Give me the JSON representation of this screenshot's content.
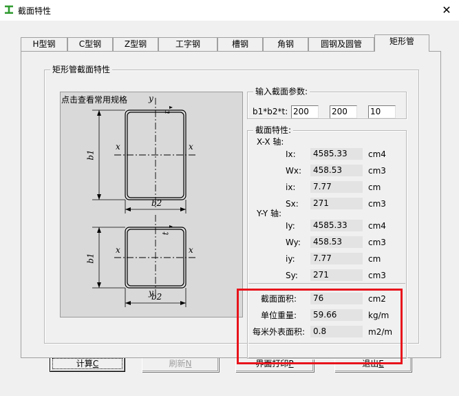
{
  "window": {
    "title": "截面特性",
    "close_glyph": "✕"
  },
  "tabs": [
    {
      "label": "H型钢"
    },
    {
      "label": "C型钢"
    },
    {
      "label": "Z型钢"
    },
    {
      "label": "工字钢"
    },
    {
      "label": "槽钢"
    },
    {
      "label": "角钢"
    },
    {
      "label": "圆钢及圆管"
    },
    {
      "label": "矩形管"
    }
  ],
  "main_group": {
    "title": "矩形管截面特性"
  },
  "diagram": {
    "link_text": "点击查看常用规格",
    "label_y": "y",
    "label_x": "x",
    "label_t": "t",
    "label_b1": "b1",
    "label_b2": "b2"
  },
  "input_group": {
    "title": "输入截面参数:",
    "param_label": "b1*b2*t:",
    "b1": "200",
    "b2": "200",
    "t": "10"
  },
  "props_group": {
    "title": "截面特性:",
    "xx_axis": "X-X 轴:",
    "yy_axis": "Y-Y 轴:",
    "rows": [
      {
        "label": "Ix:",
        "value": "4585.33",
        "unit": "cm4"
      },
      {
        "label": "Wx:",
        "value": "458.53",
        "unit": "cm3"
      },
      {
        "label": "ix:",
        "value": "7.77",
        "unit": "cm"
      },
      {
        "label": "Sx:",
        "value": "271",
        "unit": "cm3"
      },
      {
        "label": "Iy:",
        "value": "4585.33",
        "unit": "cm4"
      },
      {
        "label": "Wy:",
        "value": "458.53",
        "unit": "cm3"
      },
      {
        "label": "iy:",
        "value": "7.77",
        "unit": "cm"
      },
      {
        "label": "Sy:",
        "value": "271",
        "unit": "cm3"
      }
    ],
    "extra": [
      {
        "label": "截面面积:",
        "value": "76",
        "unit": "cm2"
      },
      {
        "label": "单位重量:",
        "value": "59.66",
        "unit": "kg/m"
      },
      {
        "label": "每米外表面积:",
        "value": "0.8",
        "unit": "m2/m"
      }
    ]
  },
  "buttons": {
    "calc": {
      "label": "计算",
      "key": "C"
    },
    "refresh": {
      "label": "刷新",
      "key": "N"
    },
    "print": {
      "label": "界面打印",
      "key": "P"
    },
    "exit": {
      "label": "退出",
      "key": "E"
    }
  },
  "colors": {
    "highlight_box": "#e8131b",
    "app_icon": "#2e9a2e"
  }
}
